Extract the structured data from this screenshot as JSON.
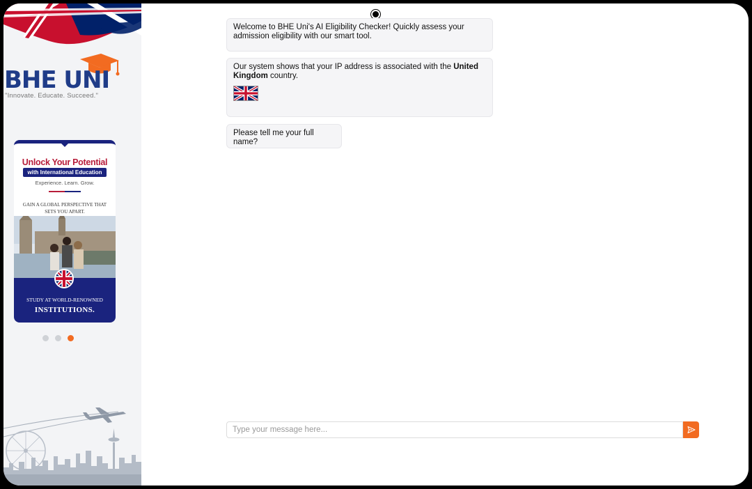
{
  "sidebar": {
    "logo_text": "BHE UNI",
    "logo_tagline": "\"Innovate. Educate. Succeed.\"",
    "promo": {
      "title": "Unlock Your Potential",
      "pill": "with International Education",
      "subtitle": "Experience. Learn. Grow.",
      "gain": "GAIN A GLOBAL PERSPECTIVE THAT SETS YOU APART.",
      "study": "STUDY AT WORLD-RENOWNED",
      "institutions": "INSTITUTIONS."
    },
    "carousel": {
      "count": 3,
      "active_index": 2
    }
  },
  "chat": {
    "messages": {
      "welcome": "Welcome to BHE Uni's AI Eligibility Checker! Quickly assess your admission eligibility with our smart tool.",
      "ip_prefix": "Our system shows that your IP address is associated with the ",
      "ip_country": "United Kingdom",
      "ip_suffix": " country.",
      "ask_name": "Please tell me your full name?"
    },
    "input": {
      "placeholder": "Type your message here...",
      "value": ""
    }
  },
  "colors": {
    "accent": "#f26b21",
    "brand_blue": "#1f3c88",
    "promo_navy": "#1a237e",
    "promo_red": "#b71c3a"
  },
  "icons": {
    "send": "send-icon",
    "flag": "uk-flag-icon"
  }
}
